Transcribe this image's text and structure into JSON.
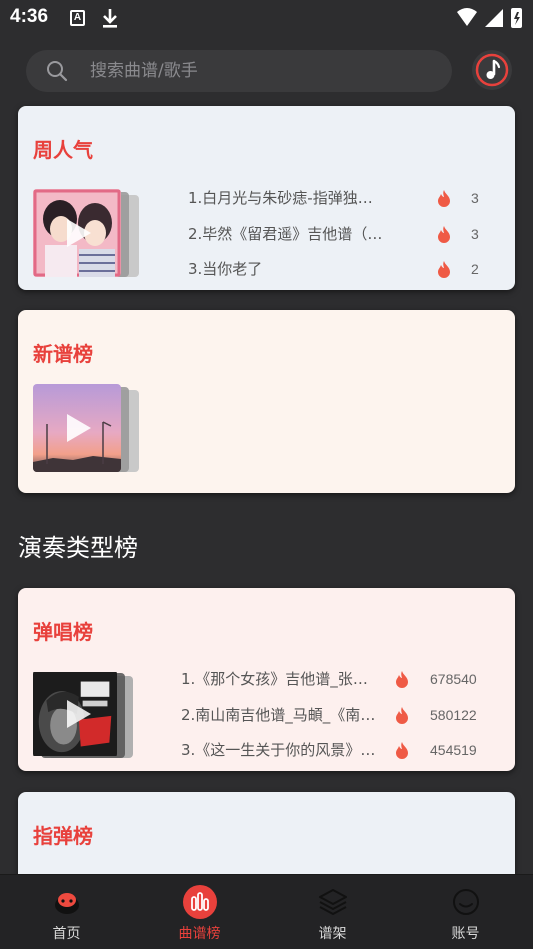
{
  "status_bar": {
    "time": "4:36",
    "a_glyph": "A"
  },
  "search": {
    "placeholder": "搜索曲谱/歌手"
  },
  "cards": {
    "weekly": {
      "title": "周人气",
      "items": [
        {
          "text": "1.白月光与朱砂痣-指弹独…",
          "count": "3"
        },
        {
          "text": "2.毕然《留君遥》吉他谱（…",
          "count": "3"
        },
        {
          "text": "3.当你老了",
          "count": "2"
        }
      ]
    },
    "new": {
      "title": "新谱榜"
    },
    "strum": {
      "title": "弹唱榜",
      "items": [
        {
          "text": "1.《那个女孩》吉他谱_张…",
          "count": "678540"
        },
        {
          "text": "2.南山南吉他谱_马頔_《南…",
          "count": "580122"
        },
        {
          "text": "3.《这一生关于你的风景》…",
          "count": "454519"
        }
      ]
    },
    "fingerstyle": {
      "title": "指弹榜"
    }
  },
  "section_heading": "演奏类型榜",
  "bottom_nav": {
    "items": [
      {
        "label": "首页",
        "icon": "home-icon"
      },
      {
        "label": "曲谱榜",
        "icon": "chart-icon",
        "active": true
      },
      {
        "label": "谱架",
        "icon": "layers-icon"
      },
      {
        "label": "账号",
        "icon": "account-icon"
      }
    ]
  },
  "colors": {
    "accent": "#e8413c",
    "background": "#2d2d2f",
    "card_weekly": "#edf1f6",
    "card_new": "#fdf4ee",
    "card_strum": "#fdf0ee",
    "card_fingerstyle": "#edf1f6"
  }
}
